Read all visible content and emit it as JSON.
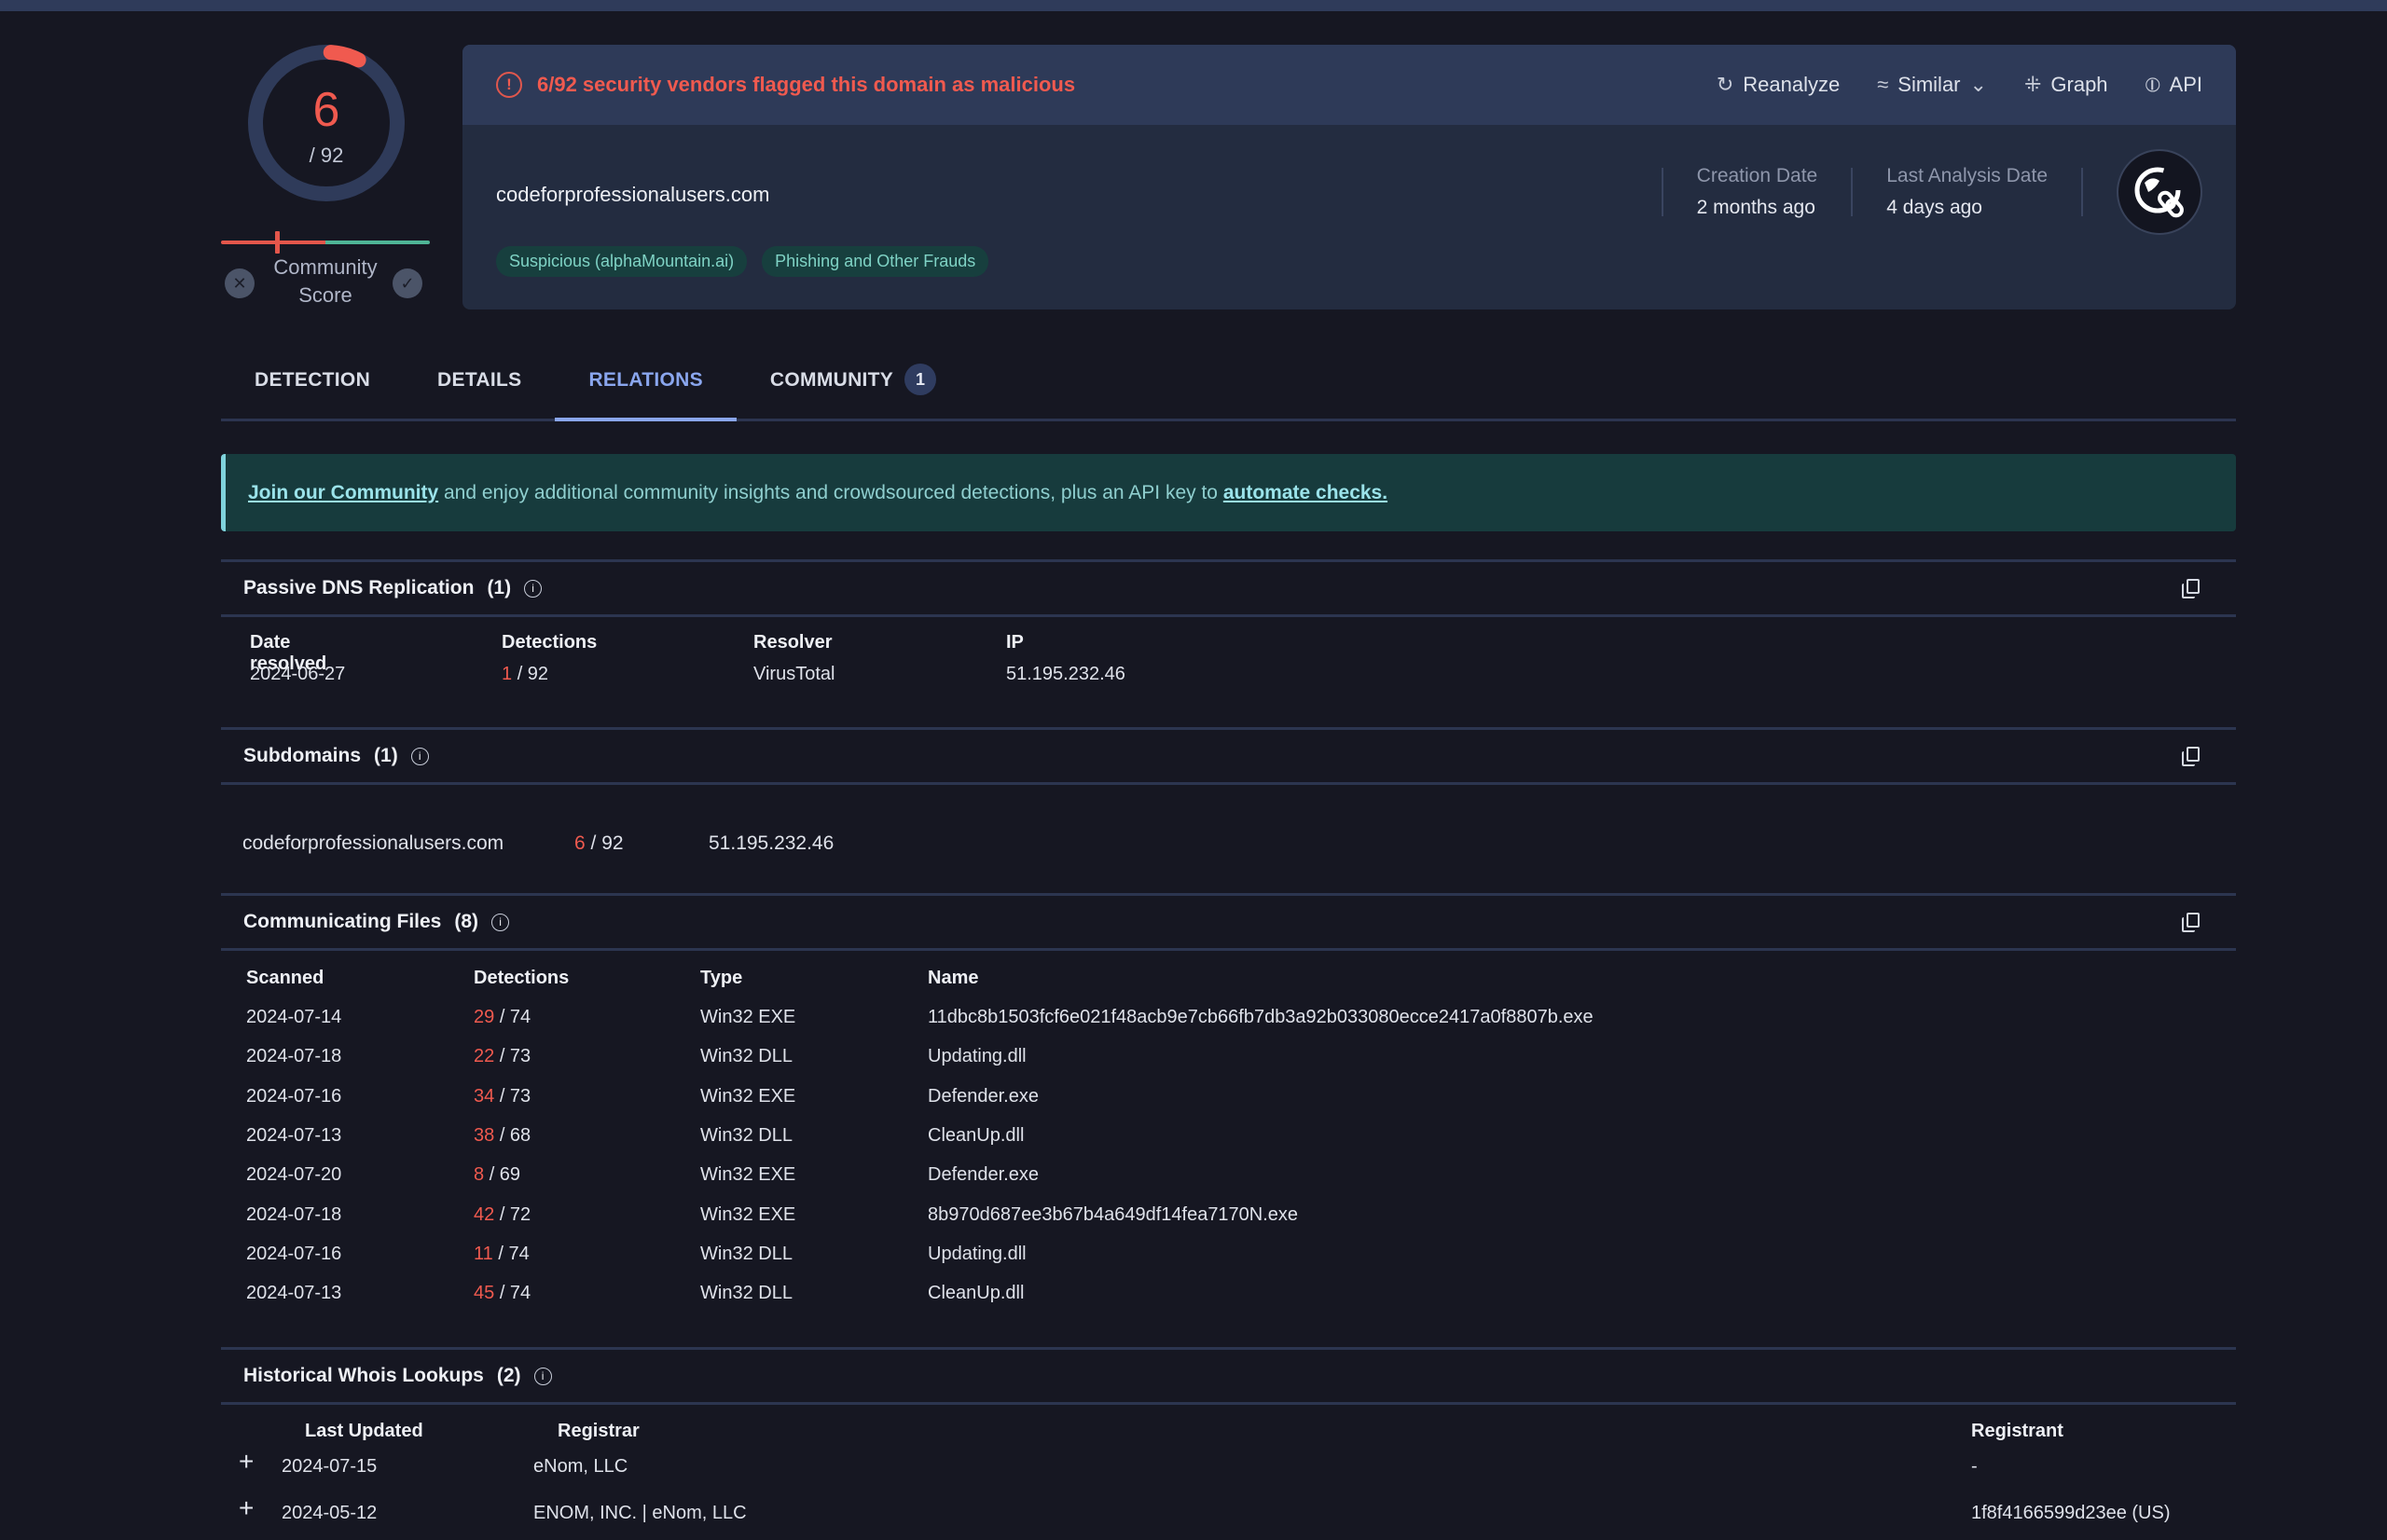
{
  "gauge": {
    "detections": "6",
    "total": "/ 92",
    "fraction": 0.0652
  },
  "community_score": {
    "label_line1": "Community",
    "label_line2": "Score",
    "marker_position": 0.27,
    "red_fraction": 0.5
  },
  "header": {
    "alert": "6/92 security vendors flagged this domain as malicious",
    "actions": [
      {
        "label": "Reanalyze",
        "icon": "refresh-icon",
        "glyph": "↻"
      },
      {
        "label": "Similar",
        "icon": "similar-icon",
        "glyph": "≈",
        "dropdown": "⌄"
      },
      {
        "label": "Graph",
        "icon": "graph-icon",
        "glyph": "⁜"
      },
      {
        "label": "API",
        "icon": "api-icon",
        "glyph": "⦶"
      }
    ],
    "domain": "codeforprofessionalusers.com",
    "tags": [
      "Suspicious (alphaMountain.ai)",
      "Phishing and Other Frauds"
    ],
    "creation_date_label": "Creation Date",
    "creation_date_value": "2 months ago",
    "last_analysis_label": "Last Analysis Date",
    "last_analysis_value": "4 days ago"
  },
  "tabs": [
    {
      "label": "DETECTION",
      "active": false
    },
    {
      "label": "DETAILS",
      "active": false
    },
    {
      "label": "RELATIONS",
      "active": true
    },
    {
      "label": "COMMUNITY",
      "active": false,
      "badge": "1"
    }
  ],
  "banner": {
    "link1": "Join our Community",
    "text": " and enjoy additional community insights and crowdsourced detections, plus an API key to ",
    "link2": "automate checks."
  },
  "passive_dns": {
    "title": "Passive DNS Replication",
    "count": "(1)",
    "columns": [
      "Date resolved",
      "Detections",
      "Resolver",
      "IP"
    ],
    "rows": [
      {
        "date": "2024-06-27",
        "det": "1",
        "total": "/ 92",
        "resolver": "VirusTotal",
        "ip": "51.195.232.46"
      }
    ]
  },
  "subdomains": {
    "title": "Subdomains",
    "count": "(1)",
    "rows": [
      {
        "domain": "codeforprofessionalusers.com",
        "det": "6",
        "total": "/ 92",
        "ip": "51.195.232.46"
      }
    ]
  },
  "communicating_files": {
    "title": "Communicating Files",
    "count": "(8)",
    "columns": [
      "Scanned",
      "Detections",
      "Type",
      "Name"
    ],
    "rows": [
      {
        "scanned": "2024-07-14",
        "det": "29",
        "total": "/ 74",
        "type": "Win32 EXE",
        "name": "11dbc8b1503fcf6e021f48acb9e7cb66fb7db3a92b033080ecce2417a0f8807b.exe"
      },
      {
        "scanned": "2024-07-18",
        "det": "22",
        "total": "/ 73",
        "type": "Win32 DLL",
        "name": "Updating.dll"
      },
      {
        "scanned": "2024-07-16",
        "det": "34",
        "total": "/ 73",
        "type": "Win32 EXE",
        "name": "Defender.exe"
      },
      {
        "scanned": "2024-07-13",
        "det": "38",
        "total": "/ 68",
        "type": "Win32 DLL",
        "name": "CleanUp.dll"
      },
      {
        "scanned": "2024-07-20",
        "det": "8",
        "total": "/ 69",
        "type": "Win32 EXE",
        "name": "Defender.exe"
      },
      {
        "scanned": "2024-07-18",
        "det": "42",
        "total": "/ 72",
        "type": "Win32 EXE",
        "name": "8b970d687ee3b67b4a649df14fea7170N.exe"
      },
      {
        "scanned": "2024-07-16",
        "det": "11",
        "total": "/ 74",
        "type": "Win32 DLL",
        "name": "Updating.dll"
      },
      {
        "scanned": "2024-07-13",
        "det": "45",
        "total": "/ 74",
        "type": "Win32 DLL",
        "name": "CleanUp.dll"
      }
    ]
  },
  "whois": {
    "title": "Historical Whois Lookups",
    "count": "(2)",
    "columns": [
      "Last Updated",
      "Registrar",
      "Registrant"
    ],
    "rows": [
      {
        "date": "2024-07-15",
        "registrar": "eNom, LLC",
        "registrant": "-"
      },
      {
        "date": "2024-05-12",
        "registrar": "ENOM, INC. | eNom, LLC",
        "registrant": "1f8f4166599d23ee (US)"
      }
    ]
  },
  "colors": {
    "malicious": "#f05a4f",
    "accent": "#8aa6ee",
    "clean": "#4fb596",
    "tag_bg": "#173f3e"
  }
}
